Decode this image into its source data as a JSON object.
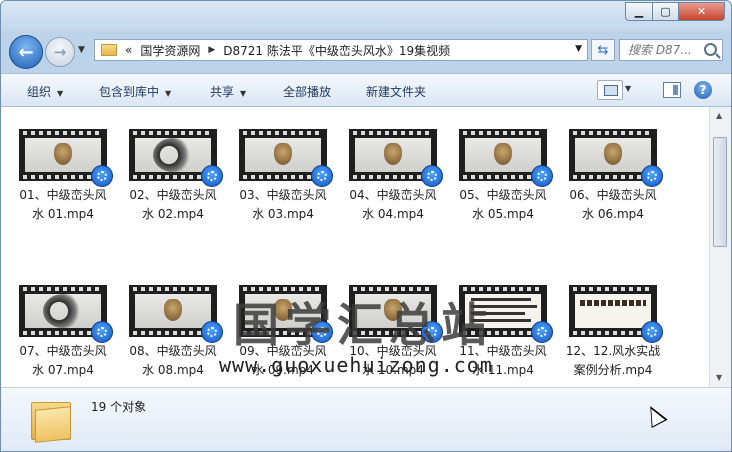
{
  "window": {
    "controls": {
      "minimize": "▁",
      "maximize": "▢",
      "close": "✕"
    }
  },
  "nav": {
    "back_glyph": "←",
    "forward_glyph": "→",
    "dropdown_glyph": "▼"
  },
  "address": {
    "prefix": "«",
    "crumbs": [
      "国学资源网",
      "D8721 陈法平《中级峦头风水》19集视频"
    ],
    "separator": "▶",
    "dropdown_glyph": "▼"
  },
  "refresh_glyph": "⇆",
  "search": {
    "placeholder": "搜索 D87..."
  },
  "toolbar": {
    "organize": "组织",
    "include_library": "包含到库中",
    "share": "共享",
    "play_all": "全部播放",
    "new_folder": "新建文件夹",
    "help": "?"
  },
  "files": [
    {
      "line1": "01、中级峦头风",
      "line2": "水 01.mp4",
      "thumb": "emblem"
    },
    {
      "line1": "02、中级峦头风",
      "line2": "水 02.mp4",
      "thumb": "ink"
    },
    {
      "line1": "03、中级峦头风",
      "line2": "水 03.mp4",
      "thumb": "emblem"
    },
    {
      "line1": "04、中级峦头风",
      "line2": "水 04.mp4",
      "thumb": "emblem"
    },
    {
      "line1": "05、中级峦头风",
      "line2": "水 05.mp4",
      "thumb": "emblem"
    },
    {
      "line1": "06、中级峦头风",
      "line2": "水 06.mp4",
      "thumb": "emblem"
    },
    {
      "line1": "07、中级峦头风",
      "line2": "水 07.mp4",
      "thumb": "ink"
    },
    {
      "line1": "08、中级峦头风",
      "line2": "水 08.mp4",
      "thumb": "emblem"
    },
    {
      "line1": "09、中级峦头风",
      "line2": "水 09.mp4",
      "thumb": "emblem"
    },
    {
      "line1": "10、中级峦头风",
      "line2": "水 10.mp4",
      "thumb": "emblem"
    },
    {
      "line1": "11、中级峦头风",
      "line2": "水 11.mp4",
      "thumb": "text"
    },
    {
      "line1": "12、12.风水实战",
      "line2": "案例分析.mp4",
      "thumb": "calligraphy"
    }
  ],
  "watermark": {
    "title": "国学汇总站",
    "url": "www.guoxuehuizong.com"
  },
  "status": {
    "count": "19 个对象"
  },
  "scroll": {
    "up_glyph": "▲",
    "down_glyph": "▼"
  }
}
